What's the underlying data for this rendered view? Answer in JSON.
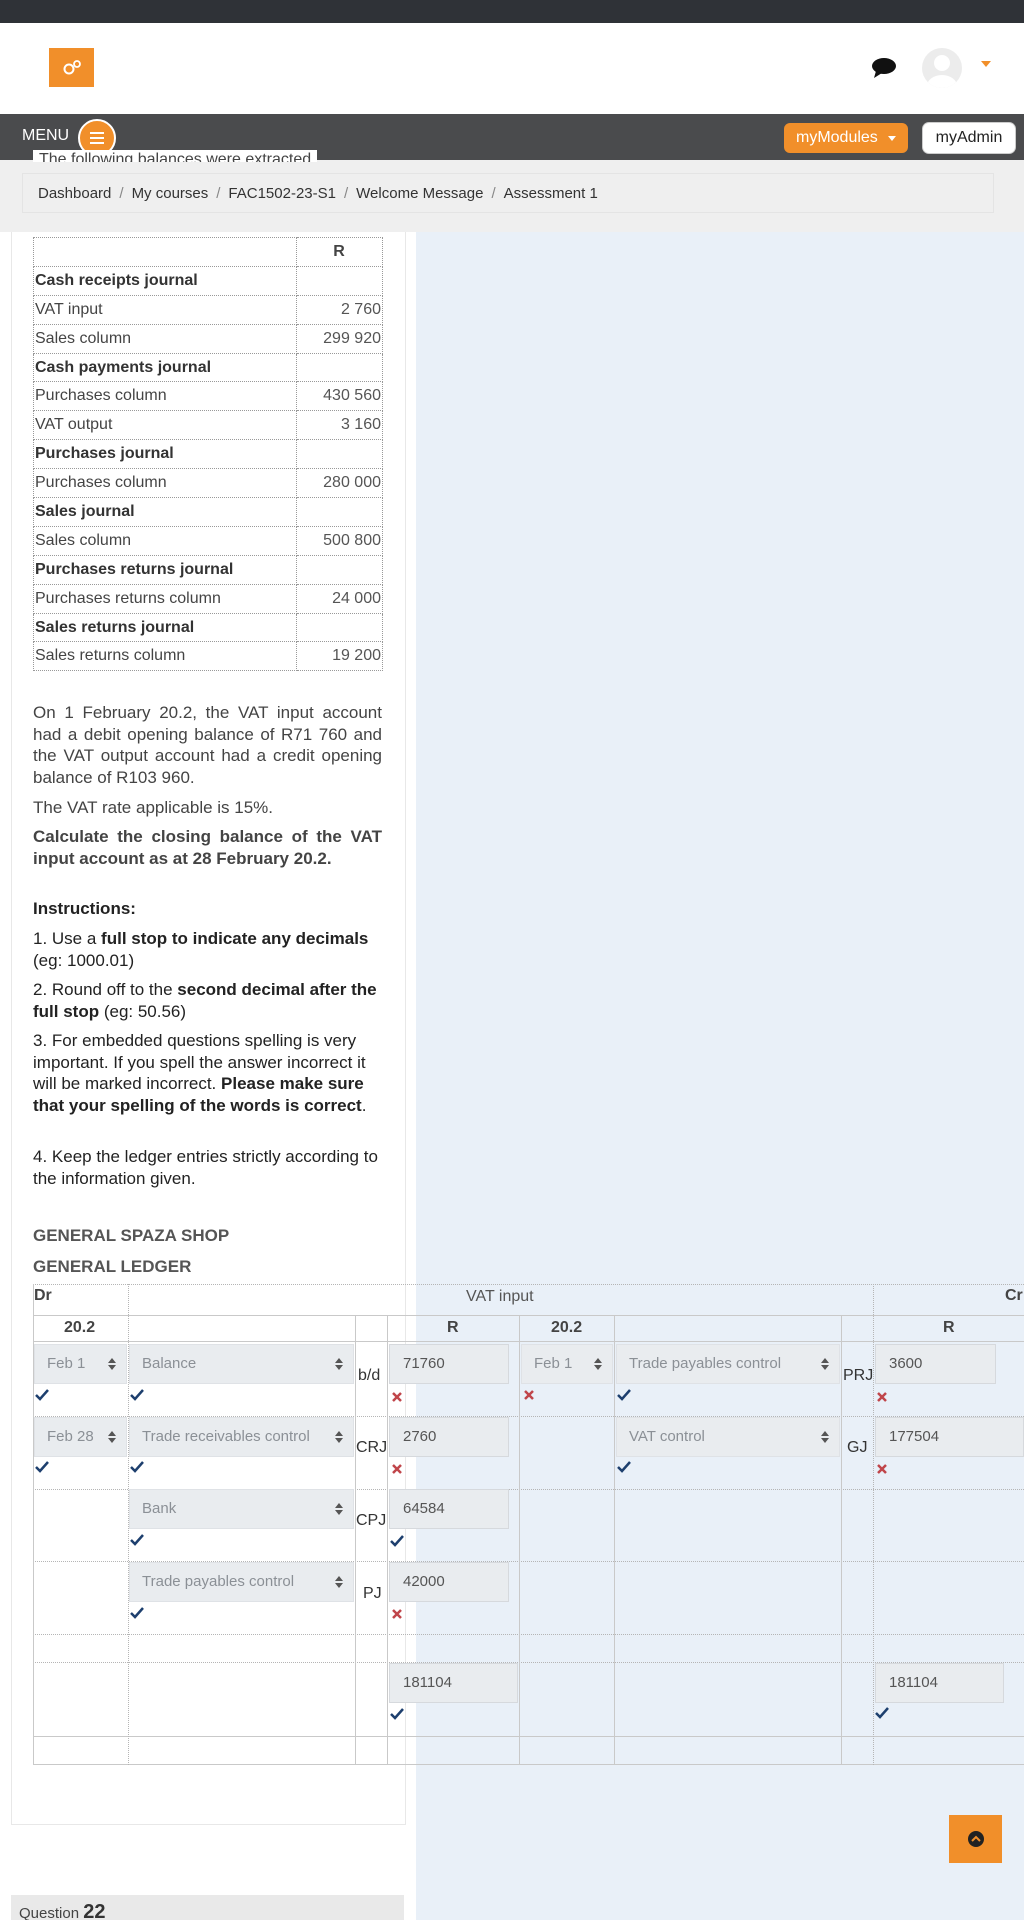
{
  "header": {
    "logo_icon": "gears-icon",
    "chat_icon": "chat-icon",
    "avatar_icon": "user-avatar-icon"
  },
  "menubar": {
    "menu_label": "MENU",
    "mymodules_label": "myModules",
    "myadmin_label": "myAdmin"
  },
  "cut_text": "The following balances were extracted",
  "breadcrumbs": [
    "Dashboard",
    "My courses",
    "FAC1502-23-S1",
    "Welcome Message",
    "Assessment 1"
  ],
  "balances": {
    "header": "R",
    "rows": [
      {
        "label": "Cash receipts journal",
        "value": "",
        "bold": true
      },
      {
        "label": "VAT input",
        "value": "2 760"
      },
      {
        "label": "Sales column",
        "value": "299 920"
      },
      {
        "label": "Cash payments journal",
        "value": "",
        "bold": true
      },
      {
        "label": "Purchases column",
        "value": "430 560"
      },
      {
        "label": "VAT output",
        "value": "3 160"
      },
      {
        "label": "Purchases journal",
        "value": "",
        "bold": true
      },
      {
        "label": "Purchases column",
        "value": "280 000"
      },
      {
        "label": "Sales journal",
        "value": "",
        "bold": true
      },
      {
        "label": "Sales column",
        "value": "500 800"
      },
      {
        "label": "Purchases returns journal",
        "value": "",
        "bold": true
      },
      {
        "label": "Purchases returns column",
        "value": "24 000"
      },
      {
        "label": "Sales returns journal",
        "value": "",
        "bold": true
      },
      {
        "label": "Sales returns column",
        "value": "19 200"
      }
    ]
  },
  "question": {
    "para1": "On 1 February 20.2, the VAT input account had a debit opening balance of R71 760 and the VAT output account had a credit opening balance of R103 960.",
    "para2": "The VAT rate applicable is 15%.",
    "para3": "Calculate the closing balance of the VAT input account as at 28 February 20.2.",
    "instructions_title": "Instructions:",
    "i1_a": "1.  Use a ",
    "i1_b": "full stop to indicate any decimals",
    "i1_c": " (eg: 1000.01)",
    "i2_a": "2.  Round off to the ",
    "i2_b": "second decimal after the full stop",
    "i2_c": " (eg: 50.56)",
    "i3_a": "3.  For embedded questions spelling is very important. If you spell the answer incorrect it will be marked incorrect. ",
    "i3_b": "Please make sure that your spelling of the words is correct",
    "i3_c": ".",
    "i4": "4.  Keep the ledger entries strictly according to the information given."
  },
  "ledger": {
    "company": "GENERAL SPAZA SHOP",
    "book": "GENERAL LEDGER",
    "dr": "Dr",
    "title": "VAT input",
    "cr": "Cr",
    "year_left": "20.2",
    "r_left": "R",
    "year_right": "20.2",
    "r_right": "R",
    "rows": {
      "r1": {
        "date": "Feb 1",
        "detail": "Balance",
        "fol": "b/d",
        "amount": "71760",
        "cr_date": "Feb 1",
        "cr_detail": "Trade payables control",
        "cr_fol": "PRJ",
        "cr_amount": "3600"
      },
      "r2": {
        "date": "Feb 28",
        "detail": "Trade receivables control",
        "fol": "CRJ",
        "amount": "2760",
        "cr_detail": "VAT control",
        "cr_fol": "GJ",
        "cr_amount": "177504"
      },
      "r3": {
        "detail": "Bank",
        "fol": "CPJ",
        "amount": "64584"
      },
      "r4": {
        "detail": "Trade payables control",
        "fol": "PJ",
        "amount": "42000"
      },
      "total": {
        "debit": "181104",
        "credit": "181104"
      }
    },
    "mark_colors": {
      "correct": "#1d3f6e",
      "incorrect": "#c0454a"
    }
  },
  "back_to_top_icon": "chevron-up-icon",
  "next_question": {
    "label": "Question",
    "number": "22"
  }
}
